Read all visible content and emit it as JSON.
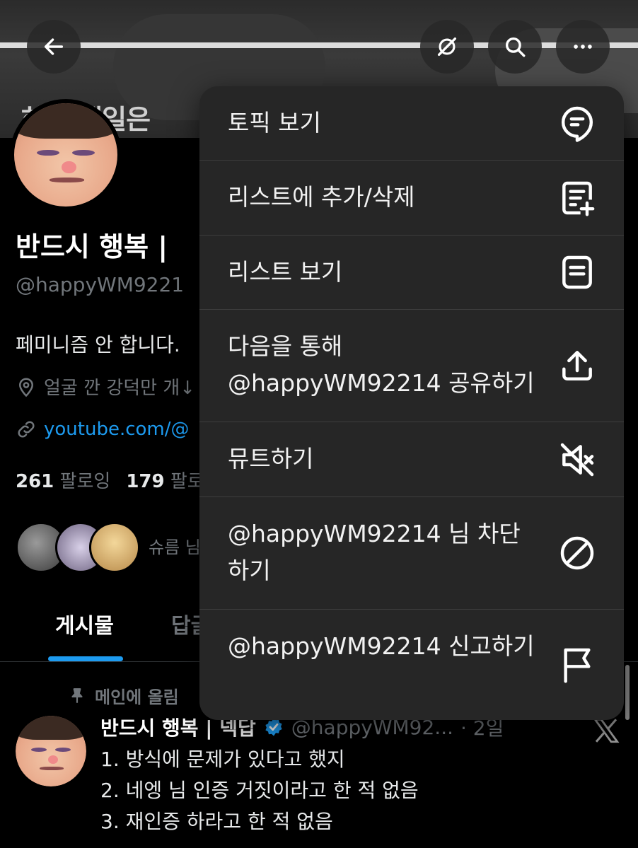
{
  "banner": {
    "caption": "하루 내일은"
  },
  "top_bar": {
    "back_icon": "back-arrow-icon",
    "icons": [
      "grok-icon",
      "search-icon",
      "more-icon"
    ]
  },
  "profile": {
    "name": "반드시 행복 |",
    "handle": "@happyWM9221",
    "bio": "페미니즘 안 합니다.",
    "location": "얼굴 깐 강덕만 개↓",
    "link": "youtube.com/@",
    "following_count": "261",
    "following_label": "팔로잉",
    "followers_count": "179",
    "followers_label": "팔로",
    "followed_by_text": "슈름 님"
  },
  "tabs": [
    {
      "label": "게시물",
      "active": true
    },
    {
      "label": "답글",
      "active": false
    }
  ],
  "post": {
    "pinned_label": "메인에 올림",
    "author_name": "반드시 행복 | 넥답",
    "author_handle": "@happyWM92...",
    "time": "· 2일",
    "lines": [
      "1. 방식에 문제가 있다고 했지",
      "2. 네엥 님 인증 거짓이라고 한 적 없음",
      "3. 재인증 하라고 한 적 없음"
    ]
  },
  "menu": {
    "items": [
      {
        "label": "토픽 보기",
        "icon": "topic-icon"
      },
      {
        "label": "리스트에 추가/삭제",
        "icon": "list-add-icon"
      },
      {
        "label": "리스트 보기",
        "icon": "list-icon"
      },
      {
        "label": "다음을 통해 @happyWM92214 공유하기",
        "icon": "share-icon"
      },
      {
        "label": "뮤트하기",
        "icon": "mute-icon"
      },
      {
        "label": "@happyWM92214 님 차단하기",
        "icon": "block-icon"
      },
      {
        "label": "@happyWM92214 신고하기",
        "icon": "flag-icon"
      }
    ]
  },
  "colors": {
    "accent": "#1d9bf0",
    "background": "#000000",
    "menu_bg": "#262626",
    "muted": "#71767b"
  }
}
